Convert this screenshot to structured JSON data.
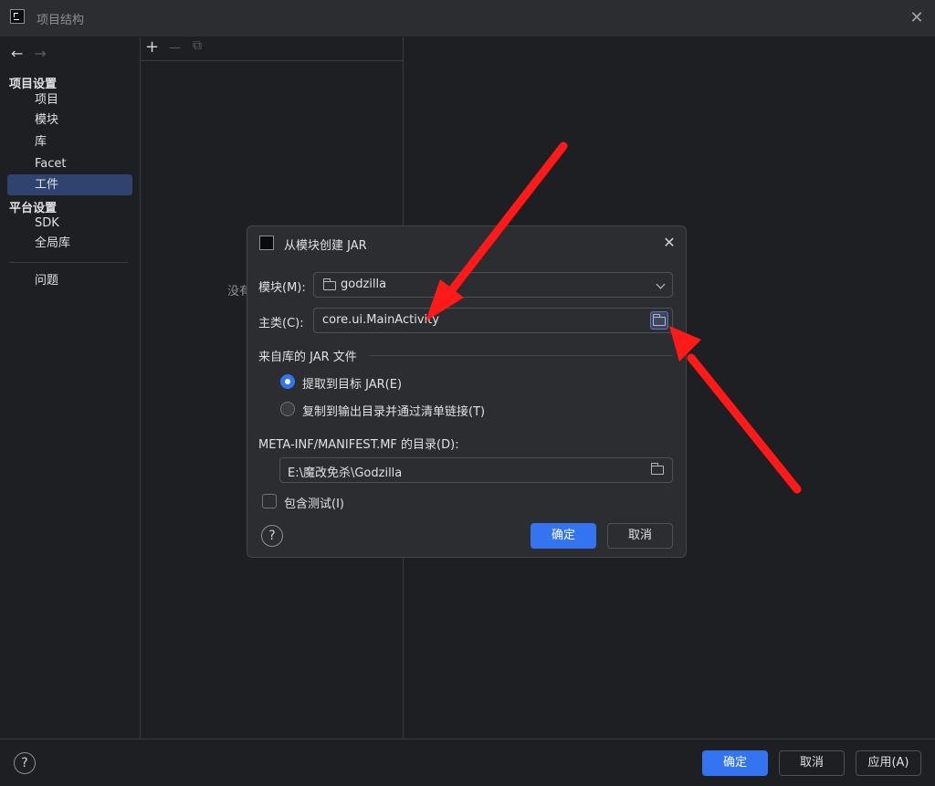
{
  "window": {
    "title": "项目结构"
  },
  "nav": {
    "project_settings_header": "项目设置",
    "items_project": [
      "项目",
      "模块",
      "库",
      "Facet",
      "工件"
    ],
    "platform_settings_header": "平台设置",
    "items_platform": [
      "SDK",
      "全局库"
    ],
    "problems": "问题",
    "back": "←",
    "forward": "→"
  },
  "middle": {
    "add": "+",
    "remove": "—",
    "copy": "⧉",
    "empty_text": "没有"
  },
  "dialog": {
    "title": "从模块创建 JAR",
    "module_label": "模块(M):",
    "module_value": "godzilla",
    "main_class_label": "主类(C):",
    "main_class_value": "core.ui.MainActivity",
    "jar_group_label": "来自库的 JAR 文件",
    "radio_extract": "提取到目标 JAR(E)",
    "radio_copy": "复制到输出目录并通过清单链接(T)",
    "manifest_label": "META-INF/MANIFEST.MF 的目录(D):",
    "manifest_value": "E:\\魔改免杀\\Godzilla",
    "include_tests": "包含测试(I)",
    "ok": "确定",
    "cancel": "取消",
    "help": "?"
  },
  "footer": {
    "ok": "确定",
    "cancel": "取消",
    "apply": "应用(A)",
    "help": "?"
  },
  "colors": {
    "accent": "#3574f0",
    "selection": "#2e436e",
    "annotation_arrow": "#ff1a1a"
  }
}
